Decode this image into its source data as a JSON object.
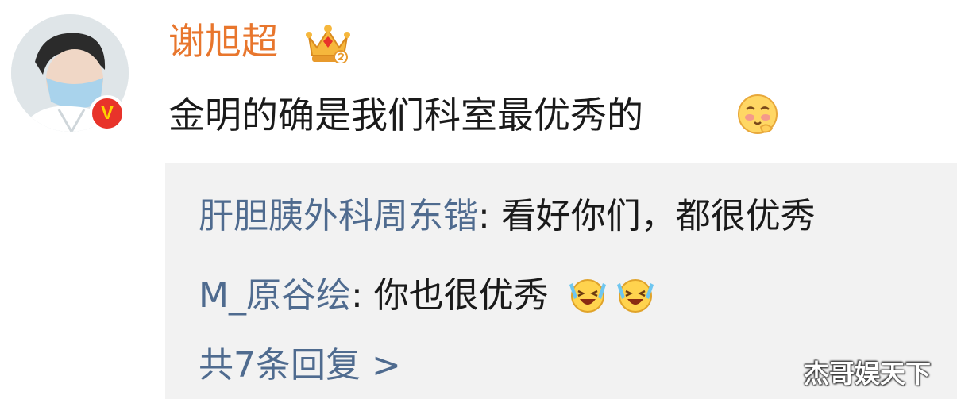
{
  "post": {
    "username": "谢旭超",
    "text": "金明的确是我们科室最优秀的",
    "verified_badge": "V",
    "avatar_icon": "doctor-avatar-icon",
    "crown_icon": "crown-icon",
    "emoji_icon": "blush-emoji-icon"
  },
  "replies": [
    {
      "user": "肝胆胰外科周东锴",
      "separator": ": ",
      "text": "看好你们，都很优秀"
    },
    {
      "user": "M_原谷绘",
      "separator": ": ",
      "text": "你也很优秀",
      "emoji_icon": "laugh-cry-emoji-icon"
    }
  ],
  "more_replies": "共7条回复 >",
  "watermark": "杰哥娱天下",
  "colors": {
    "username": "#e8762d",
    "reply_user": "#4f6b8f",
    "reply_bg": "#f2f2f2",
    "badge": "#e8332a"
  }
}
